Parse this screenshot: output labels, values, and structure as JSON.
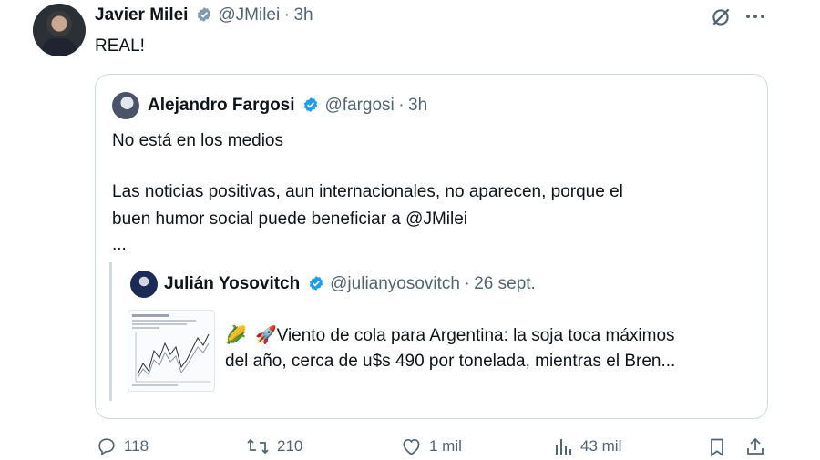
{
  "tweet": {
    "author_name": "Javier Milei",
    "author_handle": "@JMilei",
    "separator": "·",
    "time": "3h",
    "text": "REAL!"
  },
  "quote": {
    "author_name": "Alejandro Fargosi",
    "author_handle": "@fargosi",
    "separator": "·",
    "time": "3h",
    "line1": "No está en los medios",
    "line2": "Las noticias positivas, aun internacionales, no aparecen, porque el",
    "line3": "buen humor social puede beneficiar a @JMilei",
    "line4": "...",
    "nested": {
      "author_name": "Julián Yosovitch",
      "author_handle": "@julianyosovitch",
      "separator": "·",
      "time": "26 sept.",
      "line1": "Viento de cola para Argentina: la soja toca máximos",
      "line2": "del año, cerca de u$s 490 por tonelada, mientras el Bren...",
      "emoji1": "🌽",
      "emoji2": "🚀"
    }
  },
  "actions": {
    "replies": "118",
    "reposts": "210",
    "likes": "1 mil",
    "views": "43 mil"
  },
  "colors": {
    "verified": "#1d9bf0",
    "muted": "#536471",
    "border": "#cfd9de"
  }
}
